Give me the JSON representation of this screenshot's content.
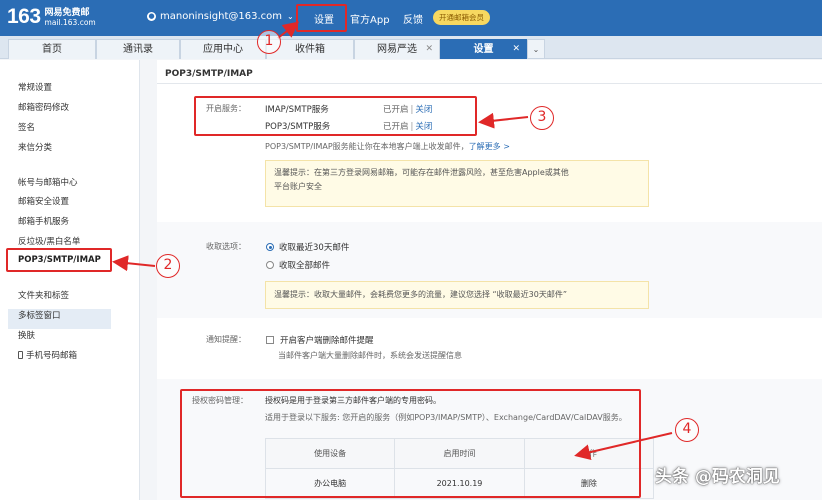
{
  "header": {
    "logo_number": "163",
    "logo_name": "网易免费邮",
    "logo_domain": "mail.163.com",
    "user_email": "manoninsight@163.com",
    "links": [
      "设置",
      "官方App",
      "反馈"
    ],
    "vip_button": "开通邮箱会员"
  },
  "tabs": [
    {
      "label": "首页"
    },
    {
      "label": "通讯录"
    },
    {
      "label": "应用中心"
    },
    {
      "label": "收件箱"
    },
    {
      "label": "网易严选"
    },
    {
      "label": "设置"
    }
  ],
  "sidebar": {
    "group1": [
      "常规设置",
      "邮箱密码修改",
      "签名",
      "来信分类"
    ],
    "group2": [
      "帐号与邮箱中心",
      "邮箱安全设置",
      "邮箱手机服务",
      "反垃圾/黑白名单"
    ],
    "active": "POP3/SMTP/IMAP",
    "group3": [
      "文件夹和标签",
      "多标签窗口",
      "换肤",
      "手机号码邮箱"
    ]
  },
  "content": {
    "title": "POP3/SMTP/IMAP",
    "service": {
      "label": "开启服务：",
      "items": [
        {
          "name": "IMAP/SMTP服务",
          "status": "已开启",
          "action": "关闭"
        },
        {
          "name": "POP3/SMTP服务",
          "status": "已开启",
          "action": "关闭"
        }
      ],
      "desc": "POP3/SMTP/IMAP服务能让你在本地客户端上收发邮件，",
      "more_link": "了解更多 >",
      "tip_line1": "温馨提示：在第三方登录网易邮箱，可能存在邮件泄露风险，甚至危害Apple或其他",
      "tip_line2": "平台账户安全"
    },
    "receive": {
      "label": "收取选项：",
      "option1": "收取最近30天邮件",
      "option2": "收取全部邮件",
      "tip": "温馨提示：收取大量邮件，会耗费您更多的流量，建议您选择 “收取最近30天邮件”"
    },
    "notify": {
      "label": "通知提醒：",
      "checkbox": "开启客户端删除邮件提醒",
      "desc": "当邮件客户端大量删除邮件时，系统会发送提醒信息"
    },
    "auth": {
      "label": "授权密码管理：",
      "desc1": "授权码是用于登录第三方邮件客户端的专用密码。",
      "desc2": "适用于登录以下服务: 您开启的服务（例如POP3/IMAP/SMTP）、Exchange/CardDAV/CalDAV服务。",
      "columns": [
        "使用设备",
        "启用时间",
        "操作"
      ],
      "rows": [
        {
          "device": "办公电脑",
          "date": "2021.10.19",
          "action": "删除"
        }
      ]
    }
  },
  "annotations": [
    "1",
    "2",
    "3",
    "4"
  ],
  "watermark": "头条 @码农洞见",
  "colors": {
    "brand": "#2b6db5",
    "annotation": "#e02828",
    "vip": "#f7d860"
  }
}
